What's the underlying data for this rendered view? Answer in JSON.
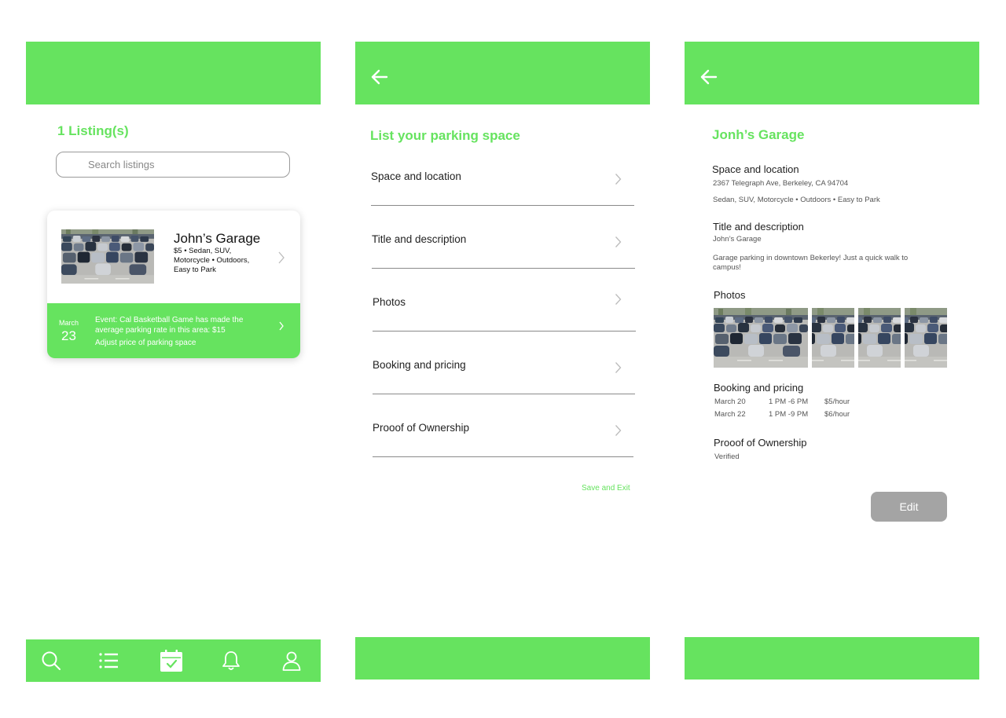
{
  "theme": {
    "accent": "#66e35f",
    "divider": "#8a8a8a",
    "button_gray": "#a4a4a4"
  },
  "my_listings": {
    "count_title": "1 Listing(s)",
    "search": {
      "placeholder": "Search listings"
    },
    "listing": {
      "title": "John’s Garage",
      "details": "$5 • Sedan, SUV, Motorcycle • Outdoors, Easy to Park",
      "photo": "parking-lot-photo",
      "event": {
        "month": "March",
        "day": "23",
        "message": "Event: Cal Basketball Game has made the average parking rate in this area: $15",
        "action": "Adjust price of parking space"
      }
    },
    "bottom_nav": [
      {
        "icon": "search-icon"
      },
      {
        "icon": "list-icon"
      },
      {
        "icon": "calendar-check-icon",
        "active": true
      },
      {
        "icon": "bell-icon"
      },
      {
        "icon": "user-icon"
      }
    ]
  },
  "list_space": {
    "title": "List your parking space",
    "items": [
      {
        "label": "Space and location"
      },
      {
        "label": "Title and description"
      },
      {
        "label": "Photos"
      },
      {
        "label": "Booking and pricing"
      },
      {
        "label": "Prooof of Ownership"
      }
    ],
    "save_exit": "Save and Exit"
  },
  "garage_detail": {
    "title": "Jonh’s Garage",
    "space": {
      "heading": "Space and location",
      "address": "2367 Telegraph Ave, Berkeley, CA 94704",
      "features": "Sedan, SUV, Motorcycle • Outdoors • Easy to Park"
    },
    "description": {
      "heading": "Title and description",
      "name": "John’s Garage",
      "text": "Garage parking in downtown Bekerley! Just a quick walk to campus!"
    },
    "photos": {
      "heading": "Photos",
      "count": 4
    },
    "booking": {
      "heading": "Booking and pricing",
      "rows": [
        {
          "date": "March 20",
          "time": "1 PM -6 PM",
          "price": "$5/hour"
        },
        {
          "date": "March 22",
          "time": "1 PM -9 PM",
          "price": "$6/hour"
        }
      ]
    },
    "ownership": {
      "heading": "Prooof of Ownership",
      "status": "Verified"
    },
    "edit_label": "Edit"
  }
}
